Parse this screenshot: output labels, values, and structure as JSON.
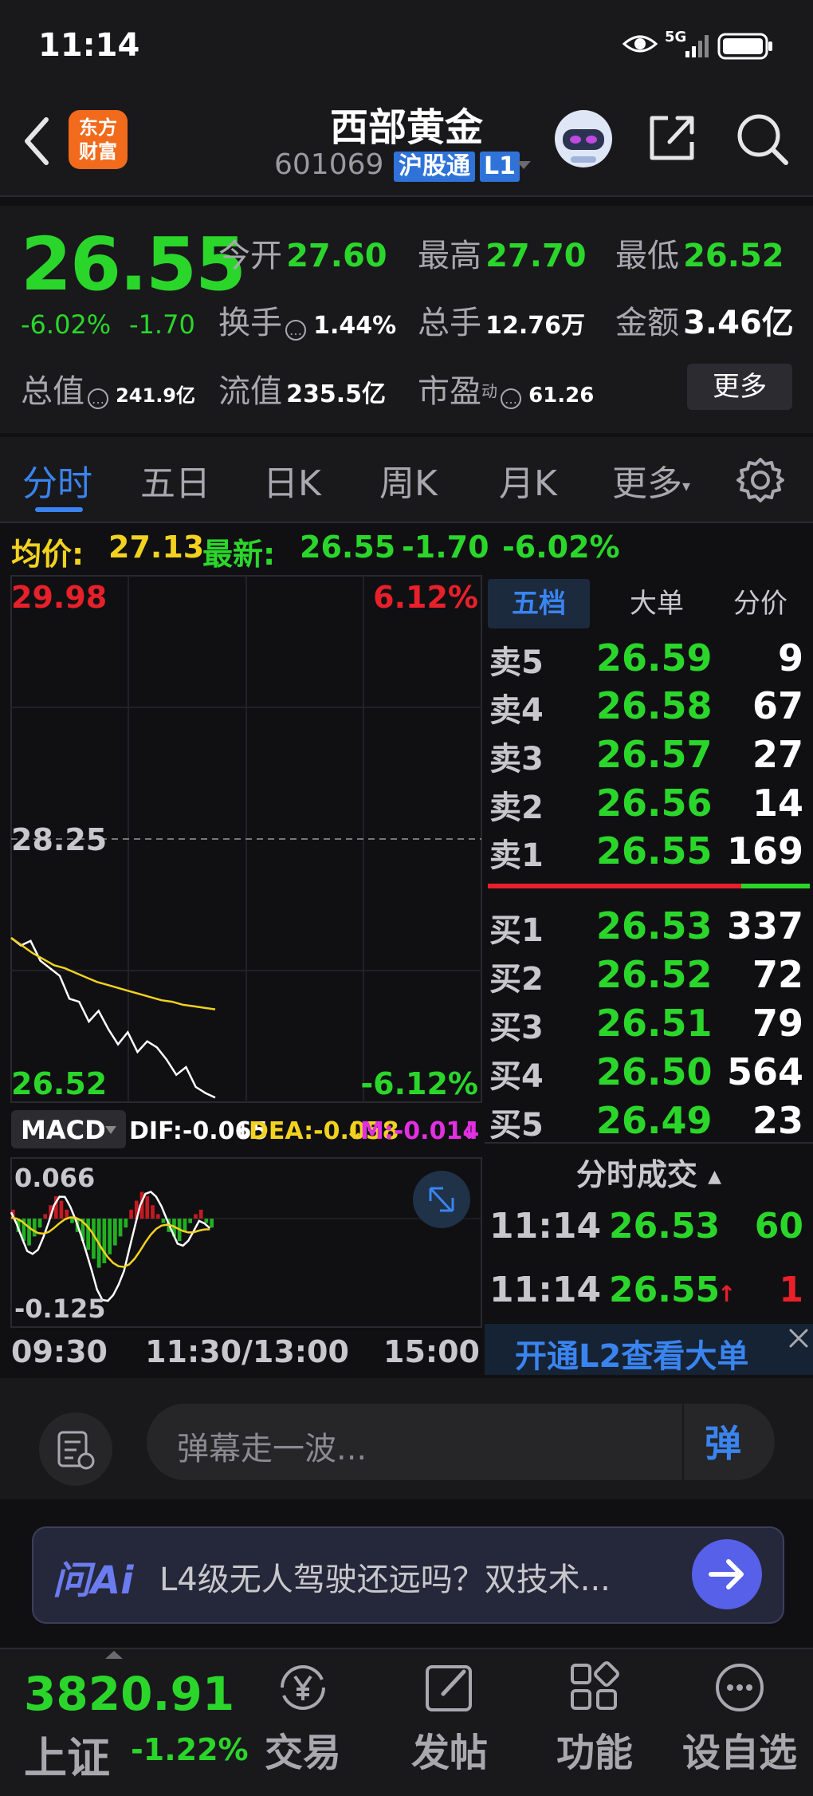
{
  "status_bar": {
    "time": "11:14"
  },
  "header": {
    "logo_line1": "东方",
    "logo_line2": "财富",
    "stock_name": "西部黄金",
    "stock_code": "601069",
    "badge_hkt": "沪股通",
    "badge_level": "L1"
  },
  "quote": {
    "price": "26.55",
    "change_pct": "-6.02%",
    "change": "-1.70",
    "fields": [
      {
        "label": "今开",
        "value": "27.60"
      },
      {
        "label": "最高",
        "value": "27.70"
      },
      {
        "label": "最低",
        "value": "26.52"
      },
      {
        "label": "换手",
        "value": "1.44%"
      },
      {
        "label": "总手",
        "value": "12.76万"
      },
      {
        "label": "金额",
        "value": "3.46亿"
      },
      {
        "label": "总值",
        "value": "241.9亿"
      },
      {
        "label": "流值",
        "value": "235.5亿"
      },
      {
        "label": "市盈",
        "value": "61.26"
      }
    ],
    "pe_superscript": "动",
    "more_label": "更多"
  },
  "tabs": [
    "分时",
    "五日",
    "日K",
    "周K",
    "月K",
    "更多"
  ],
  "avg_line": {
    "avg_label": "均价:",
    "avg_value": "27.13",
    "latest_label": "最新:",
    "latest_value": "26.55",
    "latest_change": "-1.70",
    "latest_pct": "-6.02%"
  },
  "chart": {
    "top_price": "29.98",
    "top_pct": "6.12%",
    "mid_price": "28.25",
    "low_price": "26.52",
    "low_pct": "-6.12%",
    "macd_label": "MACD",
    "dif": "DIF:-0.065",
    "dea": "DEA:-0.058",
    "m": "M:-0.014",
    "macd_top": "0.066",
    "macd_bottom": "-0.125",
    "time_start": "09:30",
    "time_mid": "11:30/13:00",
    "time_end": "15:00"
  },
  "chart_data": {
    "type": "line",
    "ylim": [
      26.52,
      29.98
    ],
    "series": [
      {
        "values": [
          27.6,
          27.55,
          27.58,
          27.45,
          27.4,
          27.35,
          27.2,
          27.18,
          27.05,
          27.12,
          27.0,
          26.9,
          26.98,
          26.85,
          26.92,
          26.88,
          26.8,
          26.7,
          26.75,
          26.62,
          26.58,
          26.55
        ]
      },
      {
        "values": [
          27.6,
          27.55,
          27.5,
          27.46,
          27.42,
          27.4,
          27.37,
          27.34,
          27.31,
          27.29,
          27.27,
          27.25,
          27.23,
          27.21,
          27.19,
          27.18,
          27.16,
          27.15,
          27.14,
          27.13
        ]
      }
    ],
    "macd_bars": [
      0.02,
      -0.03,
      -0.05,
      -0.06,
      -0.04,
      -0.02,
      0.01,
      0.03,
      0.05,
      0.04,
      0.02,
      -0.01,
      -0.03,
      -0.05,
      -0.07,
      -0.09,
      -0.11,
      -0.1,
      -0.08,
      -0.06,
      -0.04,
      -0.02,
      0.02,
      0.04,
      0.06,
      0.05,
      0.03,
      0.01,
      -0.01,
      -0.03,
      -0.04,
      -0.05,
      -0.03,
      -0.01,
      0.01,
      0.02,
      -0.01,
      -0.02
    ]
  },
  "depth": {
    "tabs": [
      "五档",
      "大单",
      "分价"
    ],
    "sells": [
      {
        "label": "卖5",
        "price": "26.59",
        "vol": "9"
      },
      {
        "label": "卖4",
        "price": "26.58",
        "vol": "67"
      },
      {
        "label": "卖3",
        "price": "26.57",
        "vol": "27"
      },
      {
        "label": "卖2",
        "price": "26.56",
        "vol": "14"
      },
      {
        "label": "卖1",
        "price": "26.55",
        "vol": "169"
      }
    ],
    "buys": [
      {
        "label": "买1",
        "price": "26.53",
        "vol": "337"
      },
      {
        "label": "买2",
        "price": "26.52",
        "vol": "72"
      },
      {
        "label": "买3",
        "price": "26.51",
        "vol": "79"
      },
      {
        "label": "买4",
        "price": "26.50",
        "vol": "564"
      },
      {
        "label": "买5",
        "price": "26.49",
        "vol": "23"
      }
    ],
    "trades_title": "分时成交",
    "trades": [
      {
        "time": "11:14",
        "price": "26.53",
        "vol": "60"
      },
      {
        "time": "11:14",
        "price": "26.55",
        "vol": "1"
      }
    ],
    "l2_promo": "开通L2查看大单"
  },
  "comment": {
    "placeholder": "弹幕走一波...",
    "danmu_label": "弹"
  },
  "ask_ai": {
    "brand": "问Ai",
    "text": "L4级无人驾驶还远吗？双技术..."
  },
  "bottom_nav": {
    "index_value": "3820.91",
    "index_name": "上证",
    "index_pct": "-1.22%",
    "items": [
      "交易",
      "发帖",
      "功能",
      "设自选"
    ]
  },
  "colors": {
    "up": "#e8202a",
    "down": "#2bd62b",
    "avg": "#f2d21e",
    "accent": "#3a84f0"
  }
}
